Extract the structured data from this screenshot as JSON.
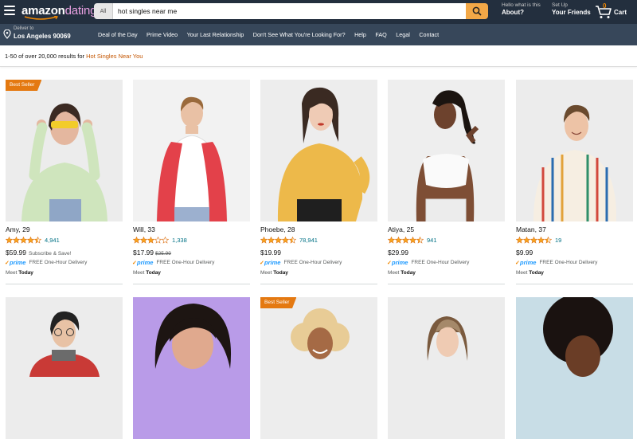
{
  "header": {
    "logo_amazon": "amazon",
    "logo_dating": "dating",
    "search_dept": "All",
    "search_value": "hot singles near me",
    "account1_small": "Hello what is this",
    "account1_big": "About?",
    "account2_small": "Set Up",
    "account2_big": "Your Friends",
    "cart_count": "0",
    "cart_label": "Cart"
  },
  "subnav": {
    "deliver_small": "Deliver to",
    "deliver_big": "Los Angeles 90069",
    "links": [
      "Deal of the Day",
      "Prime Video",
      "Your Last Relationship",
      "Don't See What You're Looking For?",
      "Help",
      "FAQ",
      "Legal",
      "Contact"
    ]
  },
  "results": {
    "prefix": "1-50 of over 20,000 results for ",
    "query": "Hot Singles Near You"
  },
  "products": [
    {
      "badge": "Best Seller",
      "name": "Amy, 29",
      "rating": 4.5,
      "reviews": "4,941",
      "price": "$59.99",
      "price_note": "Subscribe & Save!",
      "old_price": "",
      "prime": "prime",
      "delivery": "FREE One-Hour Delivery",
      "meet_prefix": "Meet",
      "meet_day": "Today"
    },
    {
      "badge": "",
      "name": "Will, 33",
      "rating": 3.0,
      "reviews": "1,338",
      "price": "$17.99",
      "price_note": "",
      "old_price": "$25.99",
      "prime": "prime",
      "delivery": "FREE One-Hour Delivery",
      "meet_prefix": "Meet",
      "meet_day": "Today"
    },
    {
      "badge": "",
      "name": "Phoebe, 28",
      "rating": 4.5,
      "reviews": "78,941",
      "price": "$19.99",
      "price_note": "",
      "old_price": "",
      "prime": "prime",
      "delivery": "FREE One-Hour Delivery",
      "meet_prefix": "Meet",
      "meet_day": "Today"
    },
    {
      "badge": "",
      "name": "Atiya, 25",
      "rating": 4.5,
      "reviews": "941",
      "price": "$29.99",
      "price_note": "",
      "old_price": "",
      "prime": "prime",
      "delivery": "FREE One-Hour Delivery",
      "meet_prefix": "Meet",
      "meet_day": "Today"
    },
    {
      "badge": "",
      "name": "Matan, 37",
      "rating": 4.5,
      "reviews": "19",
      "price": "$9.99",
      "price_note": "",
      "old_price": "",
      "prime": "prime",
      "delivery": "FREE One-Hour Delivery",
      "meet_prefix": "Meet",
      "meet_day": "Today"
    },
    {
      "badge": "",
      "name": "",
      "photo_bg": "#ececec"
    },
    {
      "badge": "",
      "name": "",
      "photo_bg": "#b99be8"
    },
    {
      "badge": "Best Seller",
      "name": "",
      "photo_bg": "#ececec"
    },
    {
      "badge": "",
      "name": "",
      "photo_bg": "#ececec"
    },
    {
      "badge": "",
      "name": "",
      "photo_bg": "#ececec"
    }
  ],
  "colors": {
    "nav_bg": "#232f3e",
    "subnav_bg": "#37475a",
    "search_button": "#f3a847",
    "badge": "#e47911",
    "link": "#007185",
    "star": "#f8a41d",
    "prime_blue": "#1a98ff",
    "query_orange": "#c45500"
  }
}
